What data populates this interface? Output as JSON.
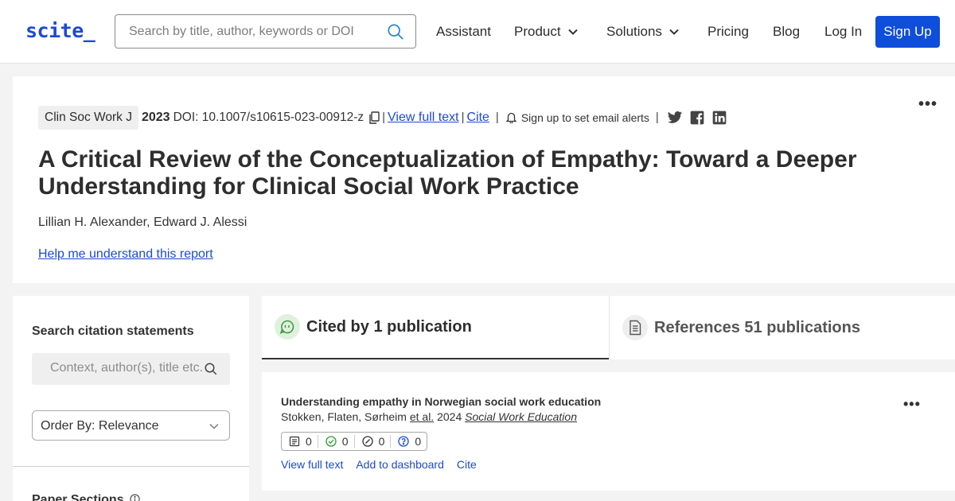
{
  "header": {
    "logo": "scite_",
    "search_placeholder": "Search by title, author, keywords or DOI",
    "nav": [
      "Assistant",
      "Product",
      "Solutions",
      "Pricing",
      "Blog",
      "Log In"
    ],
    "signup_label": "Sign Up",
    "accent_color": "#1c4ad6"
  },
  "paper": {
    "journal": "Clin Soc Work J",
    "year": "2023",
    "doi": "DOI: 10.1007/s10615-023-00912-z",
    "view_full_text": "View full text",
    "cite": "Cite",
    "alerts": "Sign up to set email alerts",
    "title": "A Critical Review of the Conceptualization of Empathy: Toward a Deeper Understanding for Clinical Social Work Practice",
    "authors": "Lillian H. Alexander, Edward J. Alessi",
    "help_link": "Help me understand this report",
    "social_icons": [
      "twitter-icon",
      "facebook-icon",
      "linkedin-icon"
    ]
  },
  "sidebar": {
    "heading": "Search citation statements",
    "search_placeholder": "Context, author(s), title etc.",
    "order_by": "Order By: Relevance",
    "sections_heading": "Paper Sections"
  },
  "tabs": {
    "cited_by": "Cited by 1 publication",
    "references": "References 51 publications"
  },
  "results": [
    {
      "title": "Understanding empathy in Norwegian social work education",
      "authors": "Stokken, Flaten, Sørheim",
      "etal": "et al.",
      "year": "2024",
      "journal": "Social Work Education",
      "counts": [
        "0",
        "0",
        "0",
        "0"
      ],
      "actions": [
        "View full text",
        "Add to dashboard",
        "Cite"
      ]
    }
  ]
}
